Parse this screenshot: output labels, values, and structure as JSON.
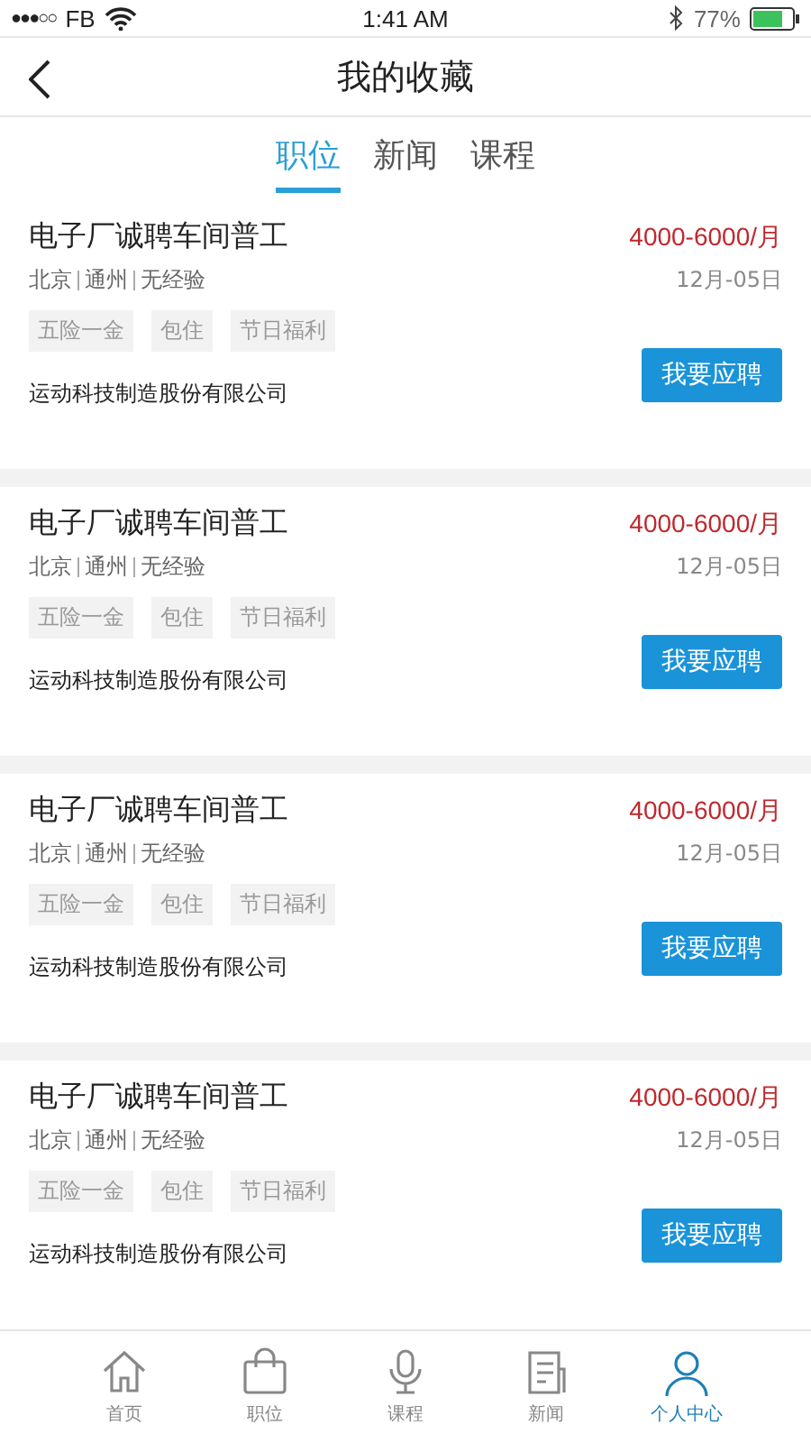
{
  "status_bar": {
    "signal": "●●●○○",
    "carrier": "FB",
    "time": "1:41 AM",
    "battery_text": "77%"
  },
  "header": {
    "title": "我的收藏"
  },
  "tabs": [
    {
      "label": "职位",
      "selected": true
    },
    {
      "label": "新闻",
      "selected": false
    },
    {
      "label": "课程",
      "selected": false
    }
  ],
  "jobs": [
    {
      "title": "电子厂诚聘车间普工",
      "salary": "4000-6000/月",
      "location": [
        "北京",
        "通州",
        "无经验"
      ],
      "date": "12月-05日",
      "tags": [
        "五险一金",
        "包住",
        "节日福利"
      ],
      "company": "运动科技制造股份有限公司",
      "button": "我要应聘"
    },
    {
      "title": "电子厂诚聘车间普工",
      "salary": "4000-6000/月",
      "location": [
        "北京",
        "通州",
        "无经验"
      ],
      "date": "12月-05日",
      "tags": [
        "五险一金",
        "包住",
        "节日福利"
      ],
      "company": "运动科技制造股份有限公司",
      "button": "我要应聘"
    },
    {
      "title": "电子厂诚聘车间普工",
      "salary": "4000-6000/月",
      "location": [
        "北京",
        "通州",
        "无经验"
      ],
      "date": "12月-05日",
      "tags": [
        "五险一金",
        "包住",
        "节日福利"
      ],
      "company": "运动科技制造股份有限公司",
      "button": "我要应聘"
    },
    {
      "title": "电子厂诚聘车间普工",
      "salary": "4000-6000/月",
      "location": [
        "北京",
        "通州",
        "无经验"
      ],
      "date": "12月-05日",
      "tags": [
        "五险一金",
        "包住",
        "节日福利"
      ],
      "company": "运动科技制造股份有限公司",
      "button": "我要应聘"
    }
  ],
  "bottom_nav": [
    {
      "kind": "home",
      "label": "首页",
      "selected": false
    },
    {
      "kind": "bag",
      "label": "职位",
      "selected": false
    },
    {
      "kind": "mic",
      "label": "课程",
      "selected": false
    },
    {
      "kind": "doc",
      "label": "新闻",
      "selected": false
    },
    {
      "kind": "person",
      "label": "个人中心",
      "selected": true
    }
  ]
}
